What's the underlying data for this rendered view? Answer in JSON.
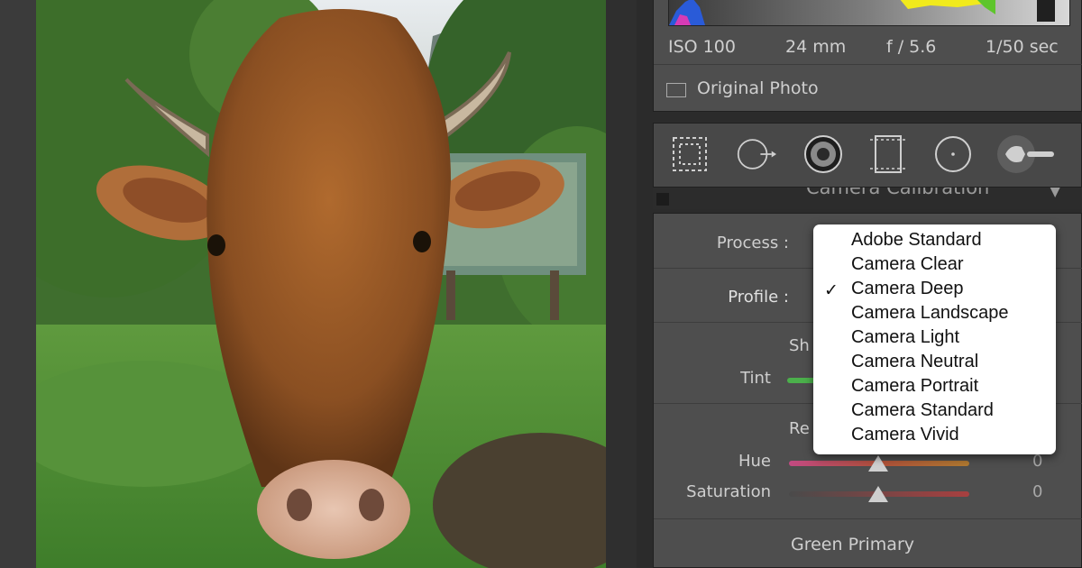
{
  "exif": {
    "iso": "ISO 100",
    "focal": "24 mm",
    "aperture": "f / 5.6",
    "shutter": "1/50 sec"
  },
  "original_photo": {
    "label": "Original Photo",
    "checked": false
  },
  "toolbar": {
    "tools": [
      "crop-overlay-icon",
      "spot-removal-icon",
      "red-eye-icon",
      "graduated-filter-icon",
      "radial-filter-icon",
      "adjustment-brush-icon"
    ]
  },
  "section": {
    "title": "Camera Calibration"
  },
  "calibration": {
    "process_label": "Process :",
    "profile_label": "Profile :",
    "shadows_heading": "Sh",
    "tint_label": "Tint",
    "red_heading": "Re",
    "hue_label": "Hue",
    "hue_value": "0",
    "saturation_label": "Saturation",
    "saturation_value": "0",
    "green_primary_heading": "Green Primary"
  },
  "dropdown": {
    "options": [
      "Adobe Standard",
      "Camera Clear",
      "Camera Deep",
      "Camera Landscape",
      "Camera Light",
      "Camera Neutral",
      "Camera Portrait",
      "Camera Standard",
      "Camera Vivid"
    ],
    "selected": "Camera Deep",
    "check_mark": "✓"
  }
}
